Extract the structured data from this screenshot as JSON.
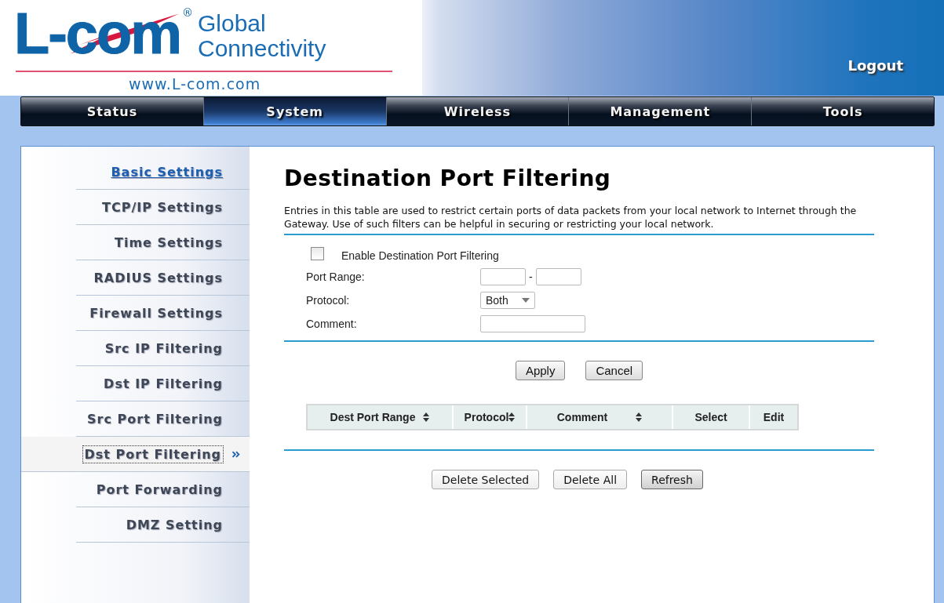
{
  "logo": {
    "wordmark": "L-com",
    "registered": "®",
    "tagline_line_1": "Global",
    "tagline_line_2": "Connectivity",
    "url": "www.L-com.com"
  },
  "logout": "Logout",
  "nav_tabs": [
    {
      "label": "Status",
      "selected": false
    },
    {
      "label": "System",
      "selected": true
    },
    {
      "label": "Wireless",
      "selected": false
    },
    {
      "label": "Management",
      "selected": false
    },
    {
      "label": "Tools",
      "selected": false
    }
  ],
  "sidebar": {
    "items": [
      {
        "label": "Basic Settings",
        "selected": false,
        "underlined": true
      },
      {
        "label": "TCP/IP Settings",
        "selected": false,
        "underlined": false
      },
      {
        "label": "Time Settings",
        "selected": false,
        "underlined": false
      },
      {
        "label": "RADIUS Settings",
        "selected": false,
        "underlined": false
      },
      {
        "label": "Firewall Settings",
        "selected": false,
        "underlined": false
      },
      {
        "label": "Src IP Filtering",
        "selected": false,
        "underlined": false
      },
      {
        "label": "Dst IP Filtering",
        "selected": false,
        "underlined": false
      },
      {
        "label": "Src Port Filtering",
        "selected": false,
        "underlined": false
      },
      {
        "label": "Dst Port Filtering",
        "selected": true,
        "underlined": false
      },
      {
        "label": "Port Forwarding",
        "selected": false,
        "underlined": false
      },
      {
        "label": "DMZ Setting",
        "selected": false,
        "underlined": false
      }
    ]
  },
  "page": {
    "title": "Destination Port Filtering",
    "description": "Entries in this table are used to restrict certain ports of data packets from your local network to Internet through the Gateway. Use of such filters can be helpful in securing or restricting your local network.",
    "enable": {
      "label": "Enable Destination Port Filtering",
      "checked": false
    },
    "port_range": {
      "label": "Port Range:",
      "separator": "-"
    },
    "protocol": {
      "label": "Protocol:",
      "value": "Both"
    },
    "comment": {
      "label": "Comment:"
    },
    "form_buttons": [
      "Apply",
      "Cancel"
    ],
    "table": {
      "columns": [
        {
          "label": "Dest Port Range",
          "sortable": true
        },
        {
          "label": "Protocol",
          "sortable": true
        },
        {
          "label": "Comment",
          "sortable": true
        },
        {
          "label": "Select",
          "sortable": false
        },
        {
          "label": "Edit",
          "sortable": false
        }
      ]
    },
    "table_buttons": [
      {
        "label": "Delete Selected",
        "focused": false
      },
      {
        "label": "Delete All",
        "focused": false
      },
      {
        "label": "Refresh",
        "focused": true
      }
    ]
  }
}
